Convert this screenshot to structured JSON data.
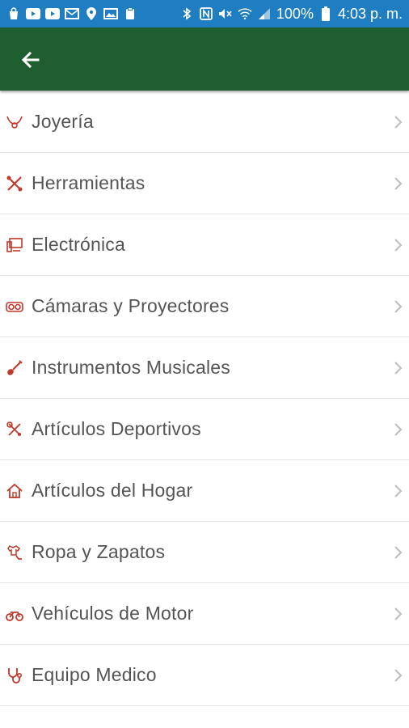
{
  "status_bar": {
    "battery_percent": "100%",
    "time": "4:03 p. m.",
    "left_icons": [
      "bag-icon",
      "youtube-icon",
      "youtube-icon",
      "mail-icon",
      "location-icon",
      "image-icon",
      "clipboard-icon"
    ],
    "right_icons": [
      "bluetooth-icon",
      "nfc-icon",
      "mute-icon",
      "wifi-icon",
      "signal-icon",
      "battery-icon"
    ]
  },
  "app_bar": {
    "back_icon": "arrow-left-icon"
  },
  "categories": [
    {
      "label": "Joyería",
      "icon": "jewelry-icon"
    },
    {
      "label": "Herramientas",
      "icon": "tools-icon"
    },
    {
      "label": "Electrónica",
      "icon": "computer-icon"
    },
    {
      "label": "Cámaras y Proyectores",
      "icon": "camera-icon"
    },
    {
      "label": "Instrumentos Musicales",
      "icon": "guitar-icon"
    },
    {
      "label": "Artículos Deportivos",
      "icon": "sports-icon"
    },
    {
      "label": "Artículos del Hogar",
      "icon": "home-icon"
    },
    {
      "label": "Ropa y Zapatos",
      "icon": "clothing-icon"
    },
    {
      "label": "Vehículos de Motor",
      "icon": "motorcycle-icon"
    },
    {
      "label": "Equipo Medico",
      "icon": "stethoscope-icon"
    }
  ],
  "colors": {
    "status_bar": "#1f7ec1",
    "app_bar": "#1e5e2e",
    "icon_accent": "#c0392b",
    "chevron": "#bdbdbd"
  }
}
